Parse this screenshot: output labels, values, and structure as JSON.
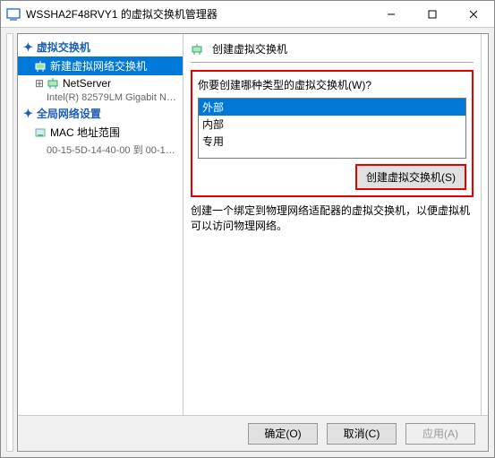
{
  "window": {
    "title": "WSSHA2F48RVY1 的虚拟交换机管理器"
  },
  "tree": {
    "switches_header": "虚拟交换机",
    "new_switch": "新建虚拟网络交换机",
    "netserver": "NetServer",
    "netserver_detail": "Intel(R) 82579LM Gigabit Network ...",
    "global_header": "全局网络设置",
    "mac_range": "MAC 地址范围",
    "mac_detail": "00-15-5D-14-40-00 到 00-15-5D-1..."
  },
  "main": {
    "header": "创建虚拟交换机",
    "prompt": "你要创建哪种类型的虚拟交换机(W)?",
    "options": {
      "external": "外部",
      "internal": "内部",
      "private": "专用"
    },
    "create_button": "创建虚拟交换机(S)",
    "description": "创建一个绑定到物理网络适配器的虚拟交换机，以便虚拟机可以访问物理网络。"
  },
  "buttons": {
    "ok": "确定(O)",
    "cancel": "取消(C)",
    "apply": "应用(A)"
  }
}
